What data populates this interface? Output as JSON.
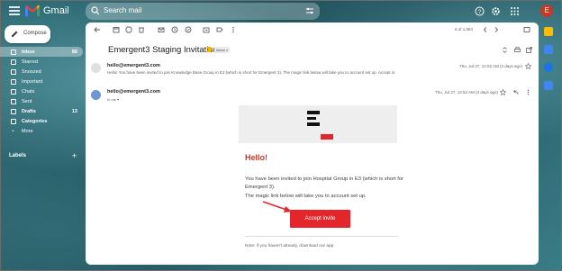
{
  "header": {
    "app_name": "Gmail",
    "search_placeholder": "Search mail",
    "avatar_letter": "E"
  },
  "sidebar": {
    "compose_label": "Compose",
    "items": [
      {
        "label": "Inbox",
        "count": "88",
        "active": true
      },
      {
        "label": "Starred",
        "count": ""
      },
      {
        "label": "Snoozed",
        "count": ""
      },
      {
        "label": "Important",
        "count": ""
      },
      {
        "label": "Chats",
        "count": ""
      },
      {
        "label": "Sent",
        "count": ""
      },
      {
        "label": "Drafts",
        "count": "13"
      },
      {
        "label": "Categories",
        "count": ""
      },
      {
        "label": "More",
        "count": ""
      }
    ],
    "labels_heading": "Labels",
    "labels_add": "+"
  },
  "toolbar": {
    "page_count": "6 of 1,864"
  },
  "thread": {
    "subject": "Emergent3 Staging Invitation",
    "inbox_tag": "Inbox ×",
    "messages": [
      {
        "sender": "hello@emergent3.com",
        "snippet": "Hello! You have been invited to join Knowledge Base Group in E3 (which is short for Emergent 3). The magic link below will take you to account set up. Accept in",
        "date": "Thu, Jul 27, 12:52 AM (3 days ago)"
      },
      {
        "sender": "hello@emergent3.com",
        "to": "to me ▾",
        "date": "Thu, Jul 27, 12:52 AM (3 days ago)"
      }
    ]
  },
  "email_body": {
    "greeting": "Hello!",
    "paragraph1": "You have been invited to join Hospital Group in E3 (which is short for Emergent 3).",
    "paragraph2": "The magic link below will take you to account set up.",
    "cta_label": "Accept invite",
    "note": "Note: if you haven't already, download our app"
  },
  "colors": {
    "brand_red": "#e3262c",
    "greeting_red": "#d93025",
    "avatar_red": "#c53929"
  }
}
